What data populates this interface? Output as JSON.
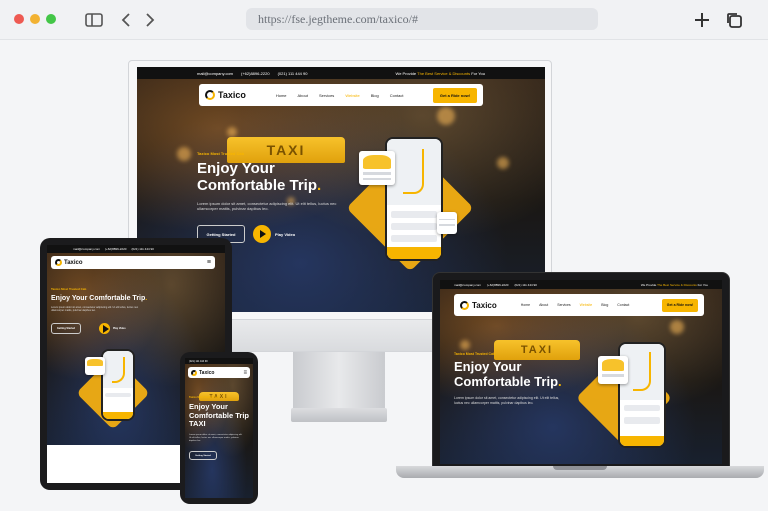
{
  "browser": {
    "url": "https://fse.jegtheme.com/taxico/#",
    "colors": {
      "close": "#ee5a52",
      "minimize": "#f2b232",
      "maximize": "#43c647"
    }
  },
  "site": {
    "brand": "Taxico",
    "accent": "#f7b500",
    "topbar": {
      "email": "mail@company.com",
      "phone1": "(+62)8896-2220",
      "phone2": "(021) 111 444 90",
      "promo_prefix": "We Provide",
      "promo_highlight": "The Best Service & Discounts",
      "promo_suffix": "For You"
    },
    "nav": {
      "items": [
        "Home",
        "About",
        "Services",
        "Website",
        "Blog",
        "Contact"
      ],
      "active": "Website",
      "cta": "Get a Ride now!"
    },
    "hero": {
      "kicker": "Taxico Most Trusted Cab",
      "title_line1": "Enjoy Your",
      "title_line2": "Comfortable Trip",
      "title_dot": ".",
      "paragraph": "Lorem ipsum dolor sit amet, consectetur adipiscing elit. Ut elit tellus, luctus nec ullamcorper mattis, pulvinar dapibus leo.",
      "button": "Getting Started",
      "play_label": "Play Video",
      "sign": "TAXI"
    }
  }
}
